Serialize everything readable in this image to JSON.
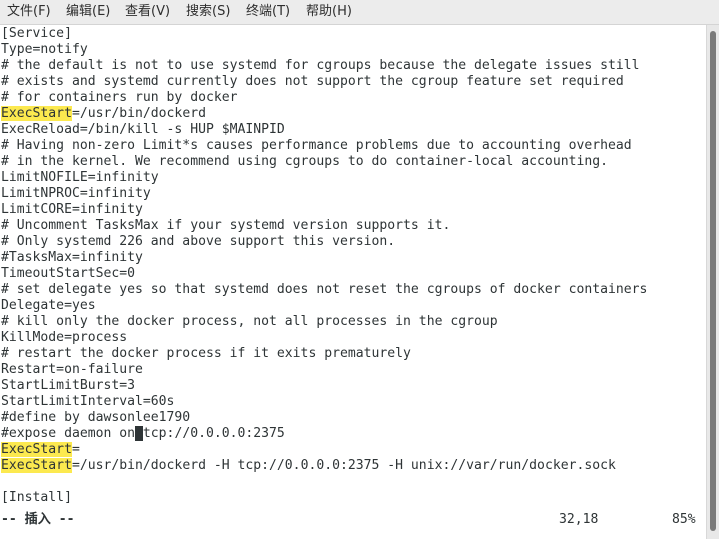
{
  "menu": {
    "file": "文件(F)",
    "edit": "编辑(E)",
    "view": "查看(V)",
    "search": "搜索(S)",
    "terminal": "终端(T)",
    "help": "帮助(H)"
  },
  "editor": {
    "lines": [
      "[Service]",
      "Type=notify",
      "# the default is not to use systemd for cgroups because the delegate issues still",
      "# exists and systemd currently does not support the cgroup feature set required",
      "# for containers run by docker",
      {
        "key": "ExecStart",
        "rest": "=/usr/bin/dockerd"
      },
      "ExecReload=/bin/kill -s HUP $MAINPID",
      "# Having non-zero Limit*s causes performance problems due to accounting overhead",
      "# in the kernel. We recommend using cgroups to do container-local accounting.",
      "LimitNOFILE=infinity",
      "LimitNPROC=infinity",
      "LimitCORE=infinity",
      "# Uncomment TasksMax if your systemd version supports it.",
      "# Only systemd 226 and above support this version.",
      "#TasksMax=infinity",
      "TimeoutStartSec=0",
      "# set delegate yes so that systemd does not reset the cgroups of docker containers",
      "Delegate=yes",
      "# kill only the docker process, not all processes in the cgroup",
      "KillMode=process",
      "# restart the docker process if it exits prematurely",
      "Restart=on-failure",
      "StartLimitBurst=3",
      "StartLimitInterval=60s",
      "#define by dawsonlee1790",
      {
        "before": "#expose daemon on",
        "cursor": " ",
        "after": "tcp://0.0.0.0:2375"
      },
      {
        "key": "ExecStart",
        "rest": "="
      },
      {
        "key": "ExecStart",
        "rest": "=/usr/bin/dockerd -H tcp://0.0.0.0:2375 -H unix://var/run/docker.sock"
      },
      "",
      "[Install]"
    ]
  },
  "status": {
    "mode": "-- 插入 --",
    "position": "32,18",
    "percent": "85%"
  },
  "colors": {
    "highlight": "#fce94f",
    "text": "#2e3436",
    "background": "#ffffff"
  }
}
